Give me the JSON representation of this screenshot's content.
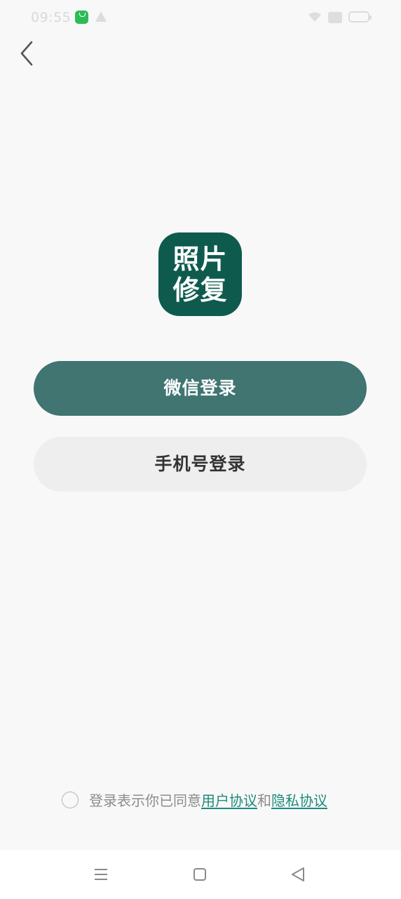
{
  "status_bar": {
    "time": "09:55"
  },
  "icons": {
    "back": "chevron-left-icon",
    "wifi": "wifi-icon",
    "battery": "battery-icon",
    "menu": "menu-icon",
    "home": "home-square-icon",
    "nav_back": "triangle-back-icon"
  },
  "logo": {
    "line1": "照片",
    "line2": "修复"
  },
  "buttons": {
    "wechat_login": "微信登录",
    "phone_login": "手机号登录"
  },
  "agreement": {
    "prefix": "登录表示你已同意",
    "user_agreement": "用户协议",
    "and": "和",
    "privacy_agreement": "隐私协议"
  },
  "colors": {
    "primary": "#407571",
    "logo_bg": "#0e5b4e",
    "link": "#1e8a7c",
    "secondary_button": "#eeeeee",
    "background": "#f8f8f8"
  }
}
